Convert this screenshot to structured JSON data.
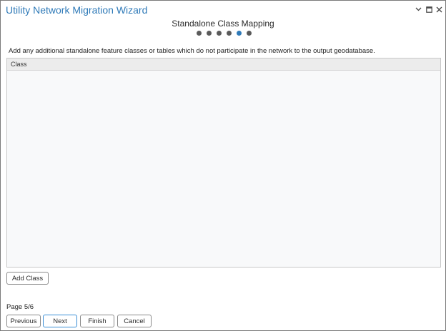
{
  "window": {
    "title": "Utility Network Migration Wizard",
    "controls": [
      "chevron-down-icon",
      "maximize-icon",
      "close-icon"
    ]
  },
  "step": {
    "title": "Standalone Class Mapping",
    "total_steps": 6,
    "current_step": 5
  },
  "instruction": "Add any additional standalone feature classes or tables which do not participate in the network to the output geodatabase.",
  "grid": {
    "columns": [
      "Class"
    ],
    "rows": []
  },
  "buttons": {
    "add_class": "Add Class",
    "previous": "Previous",
    "next": "Next",
    "finish": "Finish",
    "cancel": "Cancel"
  },
  "page_indicator": "Page 5/6",
  "colors": {
    "accent": "#2f7ab8",
    "dot_inactive": "#5a5a5a",
    "grid_bg": "#f8f9fa"
  }
}
